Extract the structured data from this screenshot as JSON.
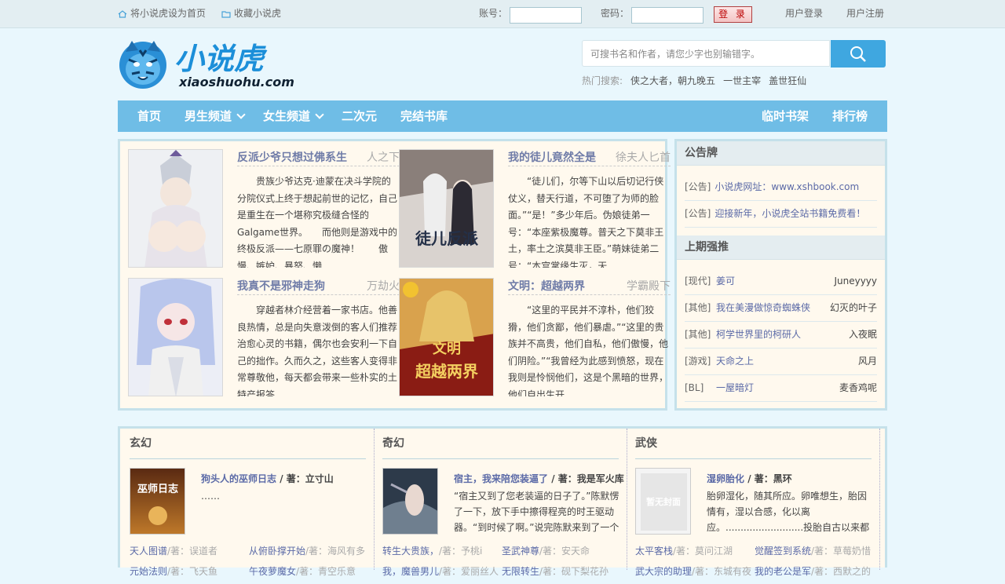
{
  "topbar": {
    "set_home": "将小说虎设为首页",
    "bookmark": "收藏小说虎",
    "account_label": "账号：",
    "password_label": "密码：",
    "login_button": "登 录",
    "user_login": "用户登录",
    "user_register": "用户注册"
  },
  "header": {
    "logo_cn": "小说虎",
    "logo_en": "xiaoshuohu.com",
    "search_placeholder": "可搜书名和作者，请您少字也别输错字。",
    "hot_label": "热门搜索:",
    "hot_items": [
      "侠之大者，朝九晚五",
      "一世主宰",
      "盖世狂仙"
    ]
  },
  "nav": {
    "home": "首页",
    "male": "男生频道",
    "female": "女生频道",
    "acg": "二次元",
    "finished": "完结书库",
    "shelf": "临时书架",
    "rank": "排行榜"
  },
  "featured": [
    {
      "title": "反派少爷只想过佛系生",
      "author": "人之下",
      "desc": "贵族少爷达克·迪蒙在决斗学院的分院仪式上终于想起前世的记忆，自己是重生在一个堪称究极缝合怪的Galgame世界。　　而他则是游戏中的终极反派——七原罪の魔神！　　傲慢、嫉妒、暴怒、懒"
    },
    {
      "title": "我的徒儿竟然全是",
      "author": "徐夫人匕首",
      "desc": "“徒儿们，尔等下山以后切记行侠仗义，替天行道，不可堕了为师的脸面。”“是！”多少年后。伪娘徒弟一号：“本座紫极魔尊。普天之下莫非王土，率土之滨莫非王臣。”萌妹徒弟二号：“本宫掌缘生灭，天"
    },
    {
      "title": "我真不是邪神走狗",
      "author": "万劫火",
      "desc": "穿越者林介经营着一家书店。他善良热情，总是向失意泼倒的客人们推荐治愈心灵的书籍，偶尔也会安利一下自己的拙作。久而久之，这些客人变得非常尊敬他，每天都会带来一些朴实的土特产报答"
    },
    {
      "title": "文明：超越两界",
      "author": "学霸殿下",
      "desc": "“这里的平民并不淳朴，他们狡猾，他们贪鄙，他们暴虐。”“这里的贵族并不高贵，他们自私，他们傲慢，他们阴险。”“我曾经为此感到愤怒，现在我则是怜悯他们，这是个黑暗的世界，他们自出生开"
    }
  ],
  "sidebar": {
    "notice_title": "公告牌",
    "notices": [
      {
        "tag": "[公告]",
        "text": "小说虎网址：www.xshbook.com"
      },
      {
        "tag": "[公告]",
        "text": "迎接新年，小说虎全站书籍免费看！"
      }
    ],
    "rec_title": "上期强推",
    "recs": [
      {
        "cat": "[现代]",
        "name": "姜可",
        "author": "Juneyyyy"
      },
      {
        "cat": "[其他]",
        "name": "我在美漫做惊奇蜘蛛侠",
        "author": "幻灭的叶子"
      },
      {
        "cat": "[其他]",
        "name": "柯学世界里的柯研人",
        "author": "入夜眠"
      },
      {
        "cat": "[游戏]",
        "name": "天命之上",
        "author": "风月"
      },
      {
        "cat": "[BL]",
        "name": "一屋暗灯",
        "author": "麦香鸡呢"
      }
    ]
  },
  "categories": [
    {
      "name": "玄幻",
      "book_title": "狗头人的巫师日志",
      "by": " / 著：立寸山",
      "desc": "……",
      "cover_text": "巫师日志",
      "list": [
        {
          "name": "天人图谱",
          "author": "/著：误道者"
        },
        {
          "name": "从俯卧撑开始",
          "author": "/著：海风有多"
        },
        {
          "name": "元始法则",
          "author": "/著：飞天鱼"
        },
        {
          "name": "午夜萝魔女",
          "author": "/著：青空乐意"
        }
      ]
    },
    {
      "name": "奇幻",
      "book_title": "宿主，我来陪您装逼了",
      "by": " / 著：我是军火库",
      "desc": "“宿主又到了您老装逼的日子了。”陈默愣了一下，放下手中擦得程亮的时王驱动器。“到时候了啊。”说完陈默来到了一个",
      "cover_text": "",
      "list": [
        {
          "name": "转生大贵族，",
          "author": "/著：予桃i"
        },
        {
          "name": "圣武神尊",
          "author": "/著：安天命"
        },
        {
          "name": "我，魔兽男儿",
          "author": "/著：爱丽丝人"
        },
        {
          "name": "无限转生",
          "author": "/著：砚下梨花孙"
        }
      ]
    },
    {
      "name": "武侠",
      "book_title": "湿卵胎化",
      "by": " / 著：黑环",
      "desc": "胎卵湿化，随其所应。卵唯想生，胎因情有，湿以合感，化以离应。..........................投胎自古以来都是一",
      "cover_text": "暂无封面",
      "list": [
        {
          "name": "太平客栈",
          "author": "/著：莫问江湖"
        },
        {
          "name": "觉醒签到系统",
          "author": "/著：草莓奶惜"
        },
        {
          "name": "武大宗的助理",
          "author": "/著：东城有夜"
        },
        {
          "name": "我的老公是军",
          "author": "/著：西默之的"
        }
      ]
    }
  ],
  "colors": {
    "nav_bg": "#6fbde6",
    "link": "#5b6aa7",
    "search_btn": "#3fa7e0",
    "panel_bg": "#fff9ee"
  }
}
